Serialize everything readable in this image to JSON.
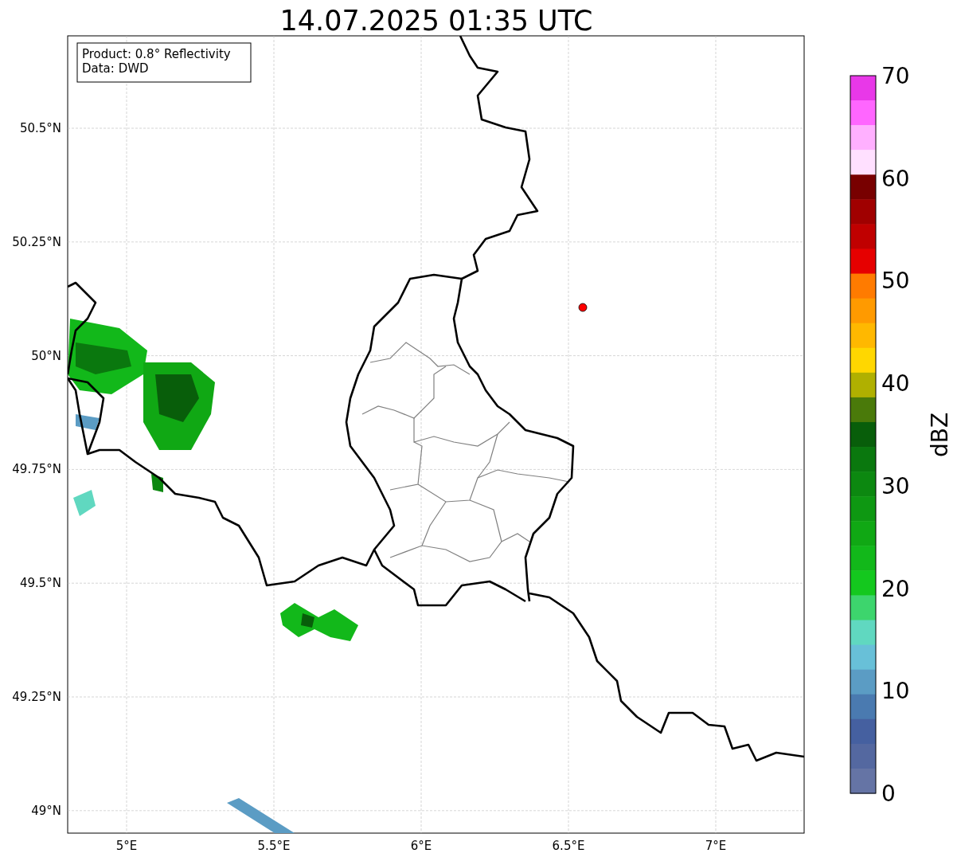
{
  "title": "14.07.2025 01:35 UTC",
  "info_box": [
    "Product: 0.8° Reflectivity",
    "Data: DWD"
  ],
  "x_ticks": [
    {
      "label": "5°E"
    },
    {
      "label": "5.5°E"
    },
    {
      "label": "6°E"
    },
    {
      "label": "6.5°E"
    },
    {
      "label": "7°E"
    }
  ],
  "y_ticks": [
    {
      "label": "50.5°N"
    },
    {
      "label": "50.25°N"
    },
    {
      "label": "50°N"
    },
    {
      "label": "49.75°N"
    },
    {
      "label": "49.5°N"
    },
    {
      "label": "49.25°N"
    },
    {
      "label": "49°N"
    }
  ],
  "colorbar": {
    "label": "dBZ",
    "ticks": [
      "70",
      "60",
      "50",
      "40",
      "30",
      "20",
      "10",
      "0"
    ],
    "segments": [
      {
        "color": "#e838e8"
      },
      {
        "color": "#ff66ff"
      },
      {
        "color": "#ffb0ff"
      },
      {
        "color": "#ffe0ff"
      },
      {
        "color": "#780000"
      },
      {
        "color": "#a00000"
      },
      {
        "color": "#c00000"
      },
      {
        "color": "#e60000"
      },
      {
        "color": "#ff7b00"
      },
      {
        "color": "#ff9a00"
      },
      {
        "color": "#ffb800"
      },
      {
        "color": "#ffd700"
      },
      {
        "color": "#b0b000"
      },
      {
        "color": "#4a7a0a"
      },
      {
        "color": "#085e0a"
      },
      {
        "color": "#0a780e"
      },
      {
        "color": "#0c8810"
      },
      {
        "color": "#0e9812"
      },
      {
        "color": "#10a814"
      },
      {
        "color": "#12b81a"
      },
      {
        "color": "#14c81e"
      },
      {
        "color": "#3dd56d"
      },
      {
        "color": "#60d8c0"
      },
      {
        "color": "#68c0d8"
      },
      {
        "color": "#5b9cc4"
      },
      {
        "color": "#4a7ab0"
      },
      {
        "color": "#4560a0"
      },
      {
        "color": "#5468a0"
      },
      {
        "color": "#6574a5"
      }
    ]
  }
}
